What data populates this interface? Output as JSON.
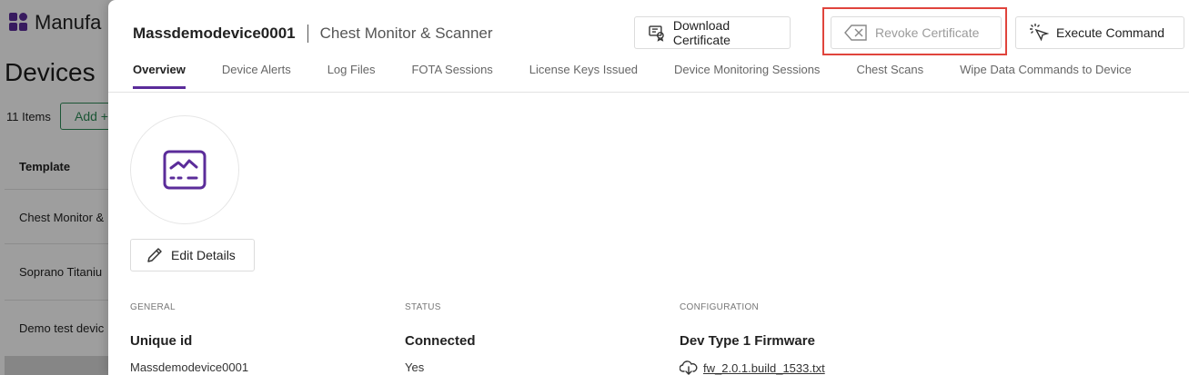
{
  "background": {
    "brand": "Manufa",
    "page_title": "Devices",
    "item_count": "11 Items",
    "add_button": "Add +",
    "column_header": "Template",
    "rows": [
      "Chest Monitor &",
      "Soprano Titaniu",
      "Demo test devic"
    ]
  },
  "header": {
    "device_name": "Massdemodevice0001",
    "device_type": "Chest Monitor & Scanner"
  },
  "actions": {
    "download_label": "Download Certificate",
    "revoke_label": "Revoke Certificate",
    "execute_label": "Execute Command"
  },
  "tabs": [
    {
      "label": "Overview",
      "active": true
    },
    {
      "label": "Device Alerts"
    },
    {
      "label": "Log Files"
    },
    {
      "label": "FOTA Sessions"
    },
    {
      "label": "License Keys Issued"
    },
    {
      "label": "Device Monitoring Sessions"
    },
    {
      "label": "Chest Scans"
    },
    {
      "label": "Wipe Data Commands to Device"
    }
  ],
  "edit_label": "Edit Details",
  "sections": {
    "general": {
      "heading": "GENERAL",
      "label": "Unique id",
      "value": "Massdemodevice0001"
    },
    "status": {
      "heading": "STATUS",
      "label": "Connected",
      "value": "Yes"
    },
    "configuration": {
      "heading": "CONFIGURATION",
      "label": "Dev Type 1 Firmware",
      "value": "fw_2.0.1.build_1533.txt"
    }
  },
  "colors": {
    "accent": "#5b2c9a",
    "highlight": "#e0443c",
    "add_green": "#2e8b57"
  }
}
